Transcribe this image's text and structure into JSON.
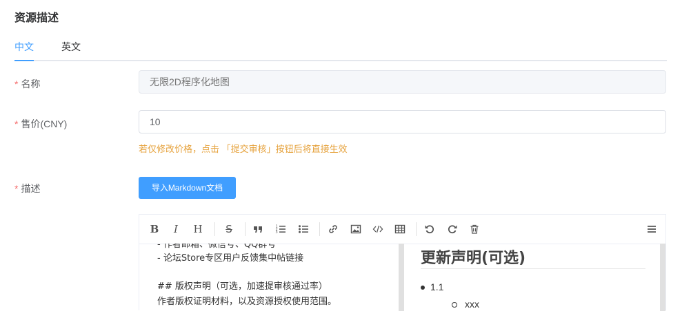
{
  "section": {
    "title": "资源描述"
  },
  "tabs": [
    {
      "label": "中文"
    },
    {
      "label": "英文"
    }
  ],
  "form": {
    "name": {
      "required_mark": "*",
      "label": "名称",
      "placeholder": "无限2D程序化地图"
    },
    "price": {
      "required_mark": "*",
      "label": "售价(CNY)",
      "value": "10",
      "hint": "若仅修改价格，点击 「提交审核」按钮后将直接生效"
    },
    "description": {
      "required_mark": "*",
      "label": "描述",
      "import_button": "导入Markdown文档"
    }
  },
  "editor": {
    "toolbar": {
      "bold": "B",
      "italic": "I",
      "heading": "H",
      "strike": "S"
    },
    "source_lines": [
      "- 作者邮箱、微信号、QQ群号",
      "- 论坛Store专区用户反馈集中帖链接",
      "",
      "## 版权声明（可选，加速提审核通过率）",
      "作者版权证明材料，以及资源授权使用范围。"
    ],
    "preview": {
      "heading": "更新声明(可选)",
      "list_item": "1.1",
      "sub_item": "xxx"
    }
  },
  "colors": {
    "accent": "#409eff",
    "required": "#f56c6c",
    "hint": "#e6a23c"
  }
}
